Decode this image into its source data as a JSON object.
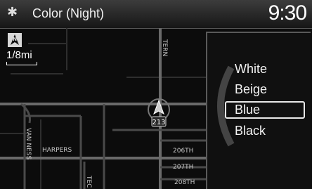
{
  "header": {
    "title": "Color (Night)",
    "clock": "9:30",
    "icon": "gear-icon"
  },
  "map": {
    "scale": "1/8mi",
    "compass_icon": "north-up-compass-icon",
    "vehicle_icon": "vehicle-position-arrow-icon",
    "route_shield": "213",
    "roads": {
      "vertical_main": "TERN",
      "van_ness": "VAN NESS",
      "harpers": "HARPERS",
      "tec": "TEC",
      "st_206": "206TH",
      "st_207": "207TH",
      "st_208": "208TH"
    }
  },
  "menu": {
    "options": [
      "White",
      "Beige",
      "Blue",
      "Black"
    ],
    "selected": "Blue"
  },
  "colors": {
    "background": "#0c0c0c",
    "road": "#5a5a5a",
    "selection_border": "#e8e8e8"
  }
}
